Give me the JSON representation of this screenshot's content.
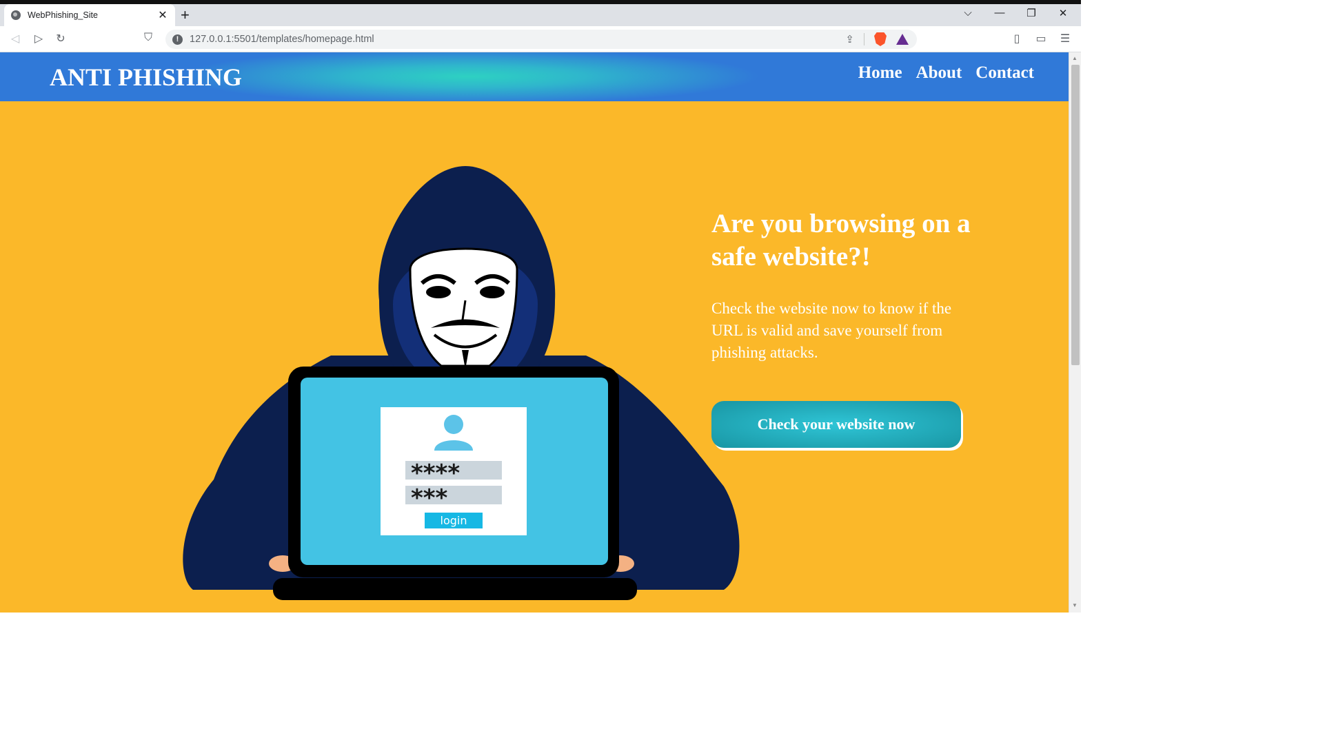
{
  "browser": {
    "tab_title": "WebPhishing_Site",
    "tab_close": "✕",
    "new_tab": "+",
    "url": "127.0.0.1:5501/templates/homepage.html",
    "info_badge": "!",
    "window_controls": {
      "dropdown": "⌵",
      "minimize": "—",
      "restore": "❐",
      "close": "✕"
    },
    "nav_icons": {
      "back": "◁",
      "forward": "▷",
      "reload": "↻",
      "bookmark": "⛉",
      "share": "⇪",
      "sidebar": "▯",
      "wallet": "▭",
      "menu": "☰"
    }
  },
  "site": {
    "brand": "ANTI PHISHING",
    "nav": [
      "Home",
      "About",
      "Contact"
    ],
    "headline": "Are you browsing on a safe website?!",
    "subtext": "Check the website now to know if the URL is valid and save yourself from phishing attacks.",
    "cta_label": "Check your website now"
  },
  "illustration": {
    "login_username_mask": "****",
    "login_password_mask": "***",
    "login_button": "login"
  },
  "colors": {
    "page_bg": "#fbb829",
    "nav_gradient_center": "#2ed1c2",
    "nav_gradient_edge": "#3079d8",
    "cta": "#1b9aa8",
    "hood": "#0c1f4e"
  }
}
